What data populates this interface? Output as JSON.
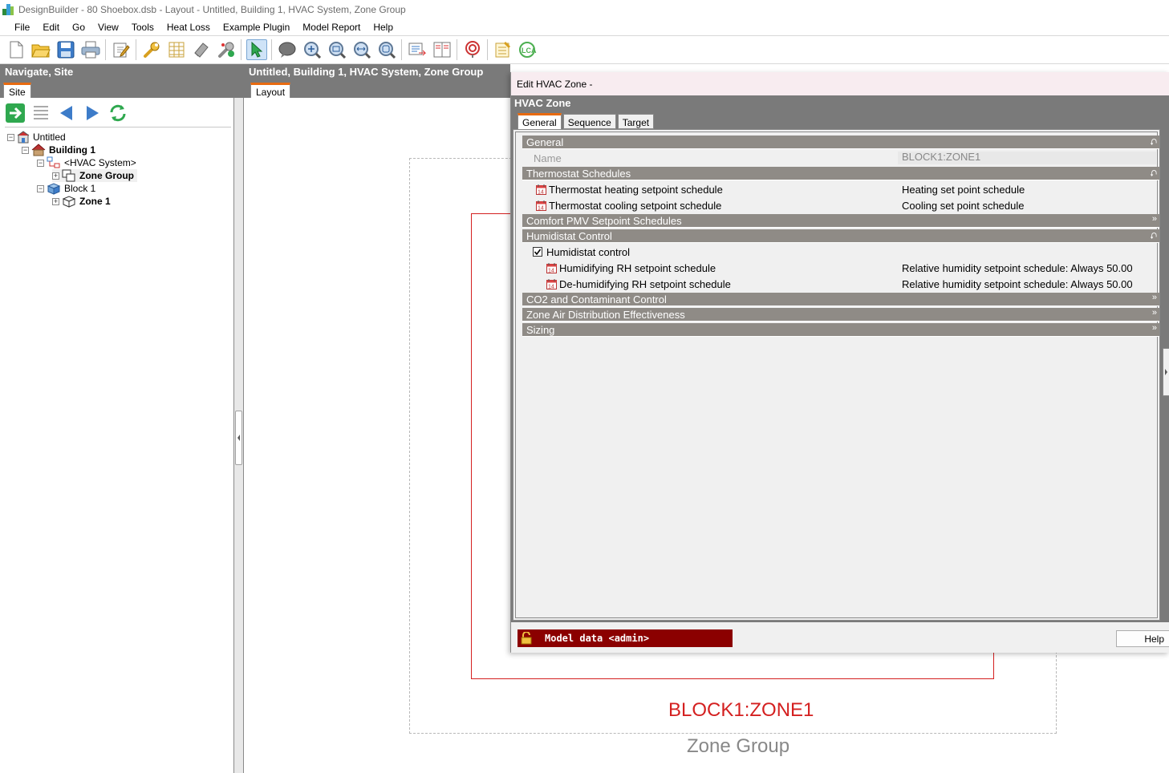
{
  "window": {
    "title": "DesignBuilder - 80 Shoebox.dsb - Layout - Untitled, Building 1, HVAC System, Zone Group"
  },
  "menu": [
    "File",
    "Edit",
    "Go",
    "View",
    "Tools",
    "Heat Loss",
    "Example Plugin",
    "Model Report",
    "Help"
  ],
  "toolbar": {
    "icons": [
      "new-file-icon",
      "open-folder-icon",
      "save-icon",
      "print-icon",
      "edit-icon",
      "wrench-icon",
      "table-icon",
      "eraser-icon",
      "magic-wrench-icon",
      "select-arrow-icon",
      "comment-icon",
      "zoom-in-icon",
      "zoom-out-icon",
      "zoom-pan-icon",
      "zoom-extents-icon",
      "export-report-icon",
      "compare-icon",
      "target-icon",
      "checklist-icon",
      "lca-icon"
    ]
  },
  "left_panel": {
    "header": "Navigate, Site",
    "tab": "Site",
    "tree": [
      {
        "label": "Untitled",
        "bold": false,
        "icon": "site-icon"
      },
      {
        "label": "Building 1",
        "bold": true,
        "icon": "building-icon"
      },
      {
        "label": "<HVAC System>",
        "bold": false,
        "icon": "hvac-system-icon"
      },
      {
        "label": "Zone Group",
        "bold": true,
        "icon": "zone-group-icon"
      },
      {
        "label": "Block 1",
        "bold": false,
        "icon": "block-icon"
      },
      {
        "label": "Zone 1",
        "bold": true,
        "icon": "zone-icon"
      }
    ]
  },
  "main": {
    "header": "Untitled, Building 1, HVAC System, Zone Group",
    "tab": "Layout",
    "zone_label": "BLOCK1:ZONE1",
    "group_label": "Zone Group"
  },
  "dialog": {
    "title": "Edit HVAC Zone -",
    "heading": "HVAC Zone",
    "tabs": [
      "General",
      "Sequence",
      "Target"
    ],
    "sections": {
      "general": "General",
      "thermostat": "Thermostat Schedules",
      "comfort": "Comfort PMV Setpoint Schedules",
      "humidistat": "Humidistat Control",
      "co2": "CO2 and Contaminant Control",
      "air_dist": "Zone Air Distribution Effectiveness",
      "sizing": "Sizing"
    },
    "name_label": "Name",
    "name_value": "BLOCK1:ZONE1",
    "heating_label": "Thermostat heating setpoint schedule",
    "heating_value": "Heating set point schedule",
    "cooling_label": "Thermostat cooling setpoint schedule",
    "cooling_value": "Cooling set point schedule",
    "humidistat_label": "Humidistat control",
    "humidistat_checked": true,
    "humidifying_label": "Humidifying RH setpoint schedule",
    "humidifying_value": "Relative humidity setpoint schedule: Always 50.00",
    "dehumidifying_label": "De-humidifying RH setpoint schedule",
    "dehumidifying_value": "Relative humidity setpoint schedule: Always 50.00",
    "model_data": "Model data <admin>",
    "help": "Help",
    "colors": {
      "section": "#8f8b86",
      "model_data_bg": "#8b0000",
      "tab_accent": "#e86a10"
    }
  }
}
